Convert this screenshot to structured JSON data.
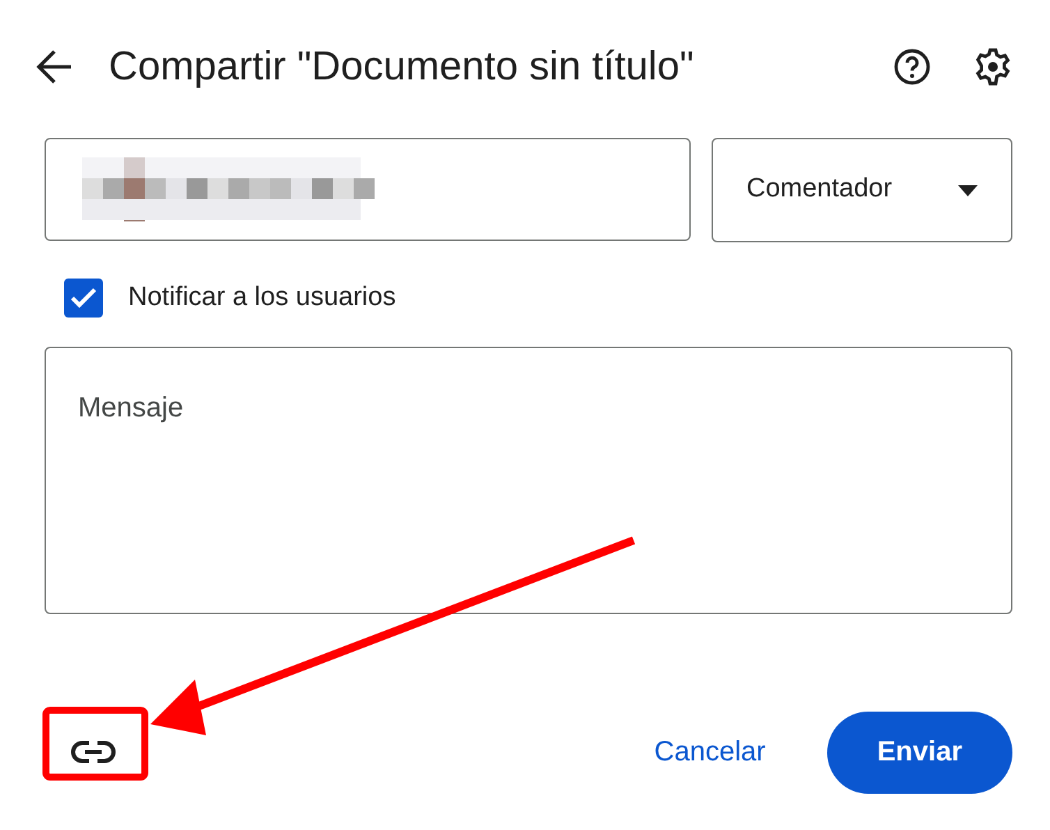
{
  "dialog": {
    "title": "Compartir \"Documento sin título\""
  },
  "recipient_field": {
    "kind": "redacted"
  },
  "role_dropdown": {
    "value": "Comentador"
  },
  "notify": {
    "label": "Notificar a los usuarios",
    "checked": true
  },
  "message": {
    "placeholder": "Mensaje"
  },
  "buttons": [
    {
      "label": "Cancelar",
      "kind": "text"
    },
    {
      "label": "Enviar",
      "kind": "filled"
    }
  ]
}
